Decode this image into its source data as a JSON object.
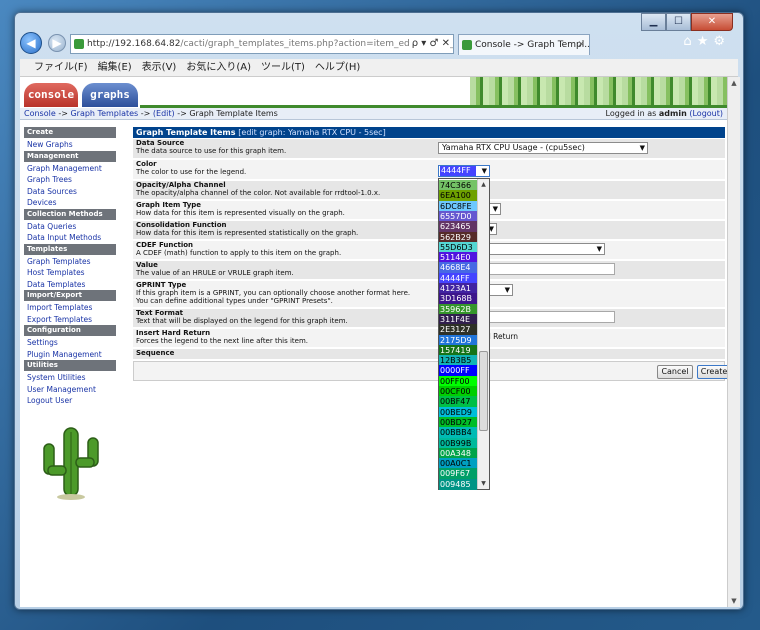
{
  "browser": {
    "url_host": "http://192.168.64.82",
    "url_path": "/cacti/graph_templates_items.php?action=item_edit&graph_tem",
    "url_tools": "ρ ▾ ♂ ✕",
    "tab_title": "Console -> Graph Templ...",
    "tab_close": "✕",
    "menu": [
      "ファイル(F)",
      "編集(E)",
      "表示(V)",
      "お気に入り(A)",
      "ツール(T)",
      "ヘルプ(H)"
    ]
  },
  "cacti": {
    "tabs": {
      "console": "console",
      "graphs": "graphs"
    },
    "breadcrumb": {
      "console": "Console",
      "sep1": "->",
      "graph_templates": "Graph Templates",
      "sep2": "->",
      "edit": "(Edit)",
      "sep3": "->",
      "current": "Graph Template Items"
    },
    "login": {
      "prefix": "Logged in as",
      "user": "admin",
      "logout": "(Logout)"
    }
  },
  "sidebar": {
    "sections": [
      {
        "header": "Create",
        "items": [
          "New Graphs"
        ]
      },
      {
        "header": "Management",
        "items": [
          "Graph Management",
          "Graph Trees",
          "Data Sources",
          "Devices"
        ]
      },
      {
        "header": "Collection Methods",
        "items": [
          "Data Queries",
          "Data Input Methods"
        ]
      },
      {
        "header": "Templates",
        "items": [
          "Graph Templates",
          "Host Templates",
          "Data Templates"
        ]
      },
      {
        "header": "Import/Export",
        "items": [
          "Import Templates",
          "Export Templates"
        ]
      },
      {
        "header": "Configuration",
        "items": [
          "Settings",
          "Plugin Management"
        ]
      },
      {
        "header": "Utilities",
        "items": [
          "System Utilities",
          "User Management",
          "Logout User"
        ]
      }
    ]
  },
  "form": {
    "title": "Graph Template Items",
    "subtitle": "[edit graph: Yamaha RTX CPU - 5sec]",
    "fields": [
      {
        "label": "Data Source",
        "desc": "The data source to use for this graph item.",
        "value": "Yamaha RTX CPU Usage - (cpu5sec)"
      },
      {
        "label": "Color",
        "desc": "The color to use for the legend.",
        "value": "4444FF"
      },
      {
        "label": "Opacity/Alpha Channel",
        "desc": "The opacity/alpha channel of the color. Not available for rrdtool-1.0.x."
      },
      {
        "label": "Graph Item Type",
        "desc": "How data for this item is represented visually on the graph."
      },
      {
        "label": "Consolidation Function",
        "desc": "How data for this item is represented statistically on the graph."
      },
      {
        "label": "CDEF Function",
        "desc": "A CDEF (math) function to apply to this item on the graph."
      },
      {
        "label": "Value",
        "desc": "The value of an HRULE or VRULE graph item."
      },
      {
        "label": "GPRINT Type",
        "desc": "If this graph item is a GPRINT, you can optionally choose another format here.",
        "desc2": "You can define additional types under \"GPRINT Presets\"."
      },
      {
        "label": "Text Format",
        "desc": "Text that will be displayed on the legend for this graph item."
      },
      {
        "label": "Insert Hard Return",
        "desc": "Forces the legend to the next line after this item.",
        "value": "d Return"
      },
      {
        "label": "Sequence"
      }
    ],
    "buttons": {
      "cancel": "Cancel",
      "create": "Create"
    }
  },
  "color_dropdown": {
    "options": [
      {
        "label": "74C366",
        "color": "#74C366"
      },
      {
        "label": "6EA100",
        "color": "#6EA100"
      },
      {
        "label": "6DC8FE",
        "color": "#6DC8FE"
      },
      {
        "label": "6557D0",
        "color": "#6557D0"
      },
      {
        "label": "623465",
        "color": "#623465"
      },
      {
        "label": "562B29",
        "color": "#562B29"
      },
      {
        "label": "55D6D3",
        "color": "#55D6D3"
      },
      {
        "label": "5114E0",
        "color": "#5114E0"
      },
      {
        "label": "4668E4",
        "color": "#4668E4"
      },
      {
        "label": "4444FF",
        "color": "#4444FF"
      },
      {
        "label": "4123A1",
        "color": "#4123A1"
      },
      {
        "label": "3D168B",
        "color": "#3D168B"
      },
      {
        "label": "35962B",
        "color": "#35962B"
      },
      {
        "label": "311F4E",
        "color": "#311F4E"
      },
      {
        "label": "2E3127",
        "color": "#2E3127"
      },
      {
        "label": "2175D9",
        "color": "#2175D9"
      },
      {
        "label": "157419",
        "color": "#157419"
      },
      {
        "label": "12B3B5",
        "color": "#12B3B5"
      },
      {
        "label": "0000FF",
        "color": "#0000FF"
      },
      {
        "label": "00FF00",
        "color": "#00FF00"
      },
      {
        "label": "00CF00",
        "color": "#00CF00"
      },
      {
        "label": "00BF47",
        "color": "#00BF47"
      },
      {
        "label": "00BED9",
        "color": "#00BED9"
      },
      {
        "label": "00BD27",
        "color": "#00BD27"
      },
      {
        "label": "00BBB4",
        "color": "#00BBB4"
      },
      {
        "label": "00B99B",
        "color": "#00B99B"
      },
      {
        "label": "00A348",
        "color": "#00A348"
      },
      {
        "label": "00A0C1",
        "color": "#00A0C1"
      },
      {
        "label": "009F67",
        "color": "#009F67"
      },
      {
        "label": "009485",
        "color": "#009485"
      }
    ]
  }
}
